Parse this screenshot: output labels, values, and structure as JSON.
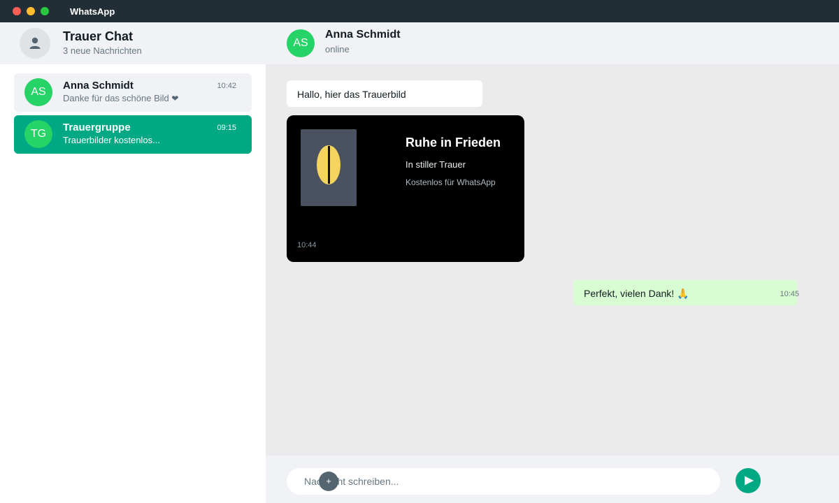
{
  "window": {
    "app_title": "WhatsApp"
  },
  "sidebar": {
    "title": "Trauer Chat",
    "subtitle": "3 neue Nachrichten",
    "profile_icon": "person-icon",
    "chats": [
      {
        "initials": "AS",
        "name": "Anna Schmidt",
        "preview": "Danke für das schöne Bild ",
        "preview_icon": "❤",
        "time": "10:42",
        "selected": false
      },
      {
        "initials": "TG",
        "name": "Trauergruppe",
        "preview": "Trauerbilder kostenlos...",
        "time": "09:15",
        "selected": true
      }
    ]
  },
  "conversation": {
    "contact_initials": "AS",
    "contact_name": "Anna Schmidt",
    "contact_status": "online",
    "messages": [
      {
        "direction": "incoming",
        "text": "Hallo, hier das Trauerbild"
      },
      {
        "direction": "incoming",
        "type": "image",
        "card": {
          "title": "Ruhe in Frieden",
          "subtitle": "In stiller Trauer",
          "note": "Kostenlos für WhatsApp",
          "thumbnail_icon": "candle-flame-icon"
        },
        "time": "10:44"
      },
      {
        "direction": "outgoing",
        "text": "Perfekt, vielen Dank! ",
        "emoji": "🙏",
        "time": "10:45"
      }
    ]
  },
  "composer": {
    "placeholder": "Nachricht schreiben...",
    "attach_label": "+",
    "send_icon": "send-icon"
  },
  "colors": {
    "accent": "#00a884",
    "avatar": "#25d366",
    "titlebar": "#222e35",
    "outgoing_bubble": "#d9fdd3",
    "chat_background": "#ebebeb"
  }
}
